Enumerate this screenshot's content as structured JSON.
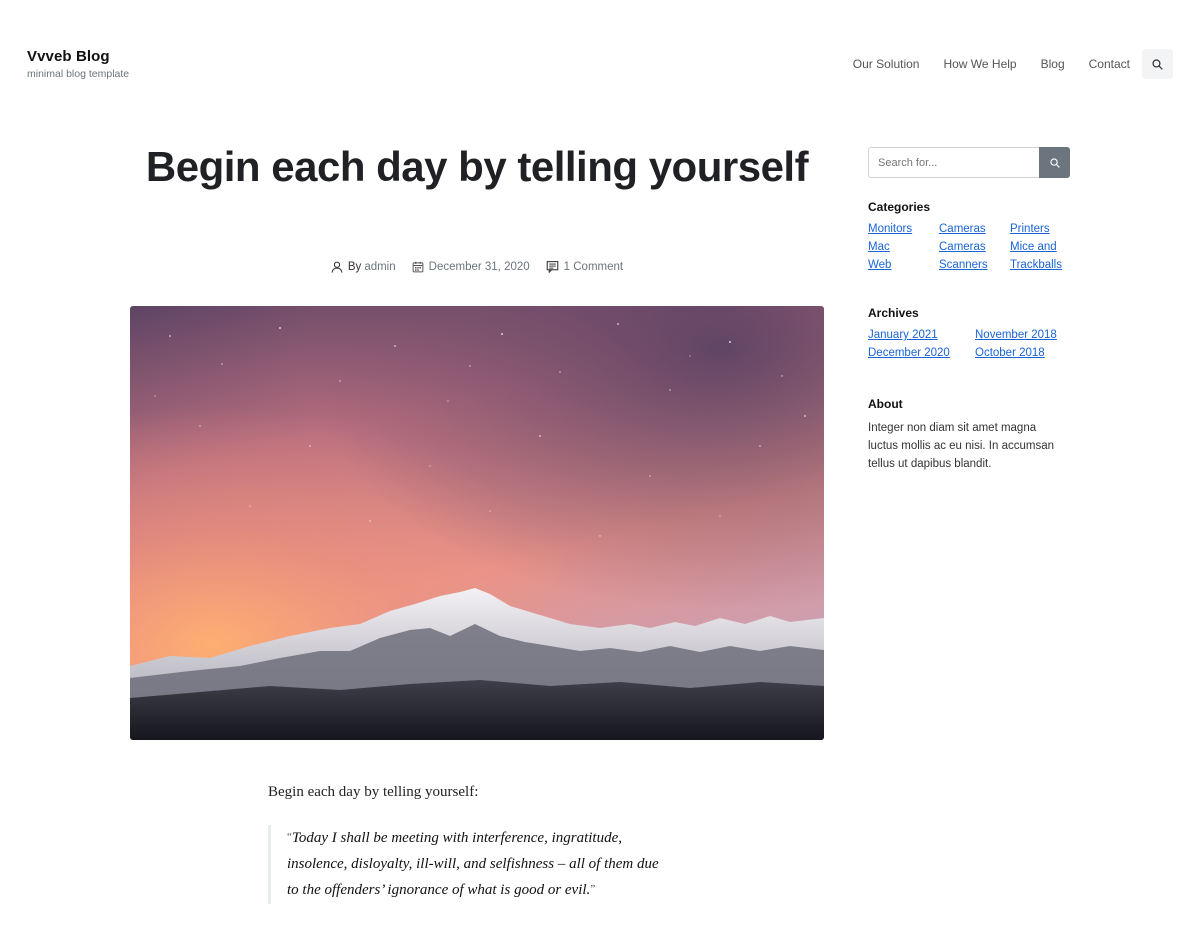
{
  "site": {
    "title": "Vvveb Blog",
    "tagline": "minimal blog template"
  },
  "nav": {
    "items": [
      "Our Solution",
      "How We Help",
      "Blog",
      "Contact"
    ],
    "search_icon": "search-icon"
  },
  "post": {
    "title": "Begin each day by telling yourself",
    "meta": {
      "by_label": "By",
      "author": "admin",
      "date": "December 31, 2020",
      "comments": "1 Comment"
    },
    "lead": "Begin each day by telling yourself:",
    "quote": "Today I shall be meeting with interference, ingratitude, insolence, disloyalty, ill-will, and selfishness – all of them due to the offenders’ ignorance of what is good or evil."
  },
  "sidebar": {
    "search_placeholder": "Search for...",
    "categories_title": "Categories",
    "categories": [
      "Monitors",
      "Cameras",
      "Printers",
      "Mac",
      "Cameras",
      "Mice and",
      "Web",
      "Scanners",
      "Trackballs"
    ],
    "archives_title": "Archives",
    "archives": [
      "January 2021",
      "November 2018",
      "December 2020",
      "October 2018"
    ],
    "about_title": "About",
    "about_text": "Integer non diam sit amet magna luctus mollis ac eu nisi. In accumsan tellus ut dapibus blandit."
  },
  "colors": {
    "link": "#1a64d6",
    "search_button": "#6c757d",
    "text_dark": "#1f2124"
  }
}
